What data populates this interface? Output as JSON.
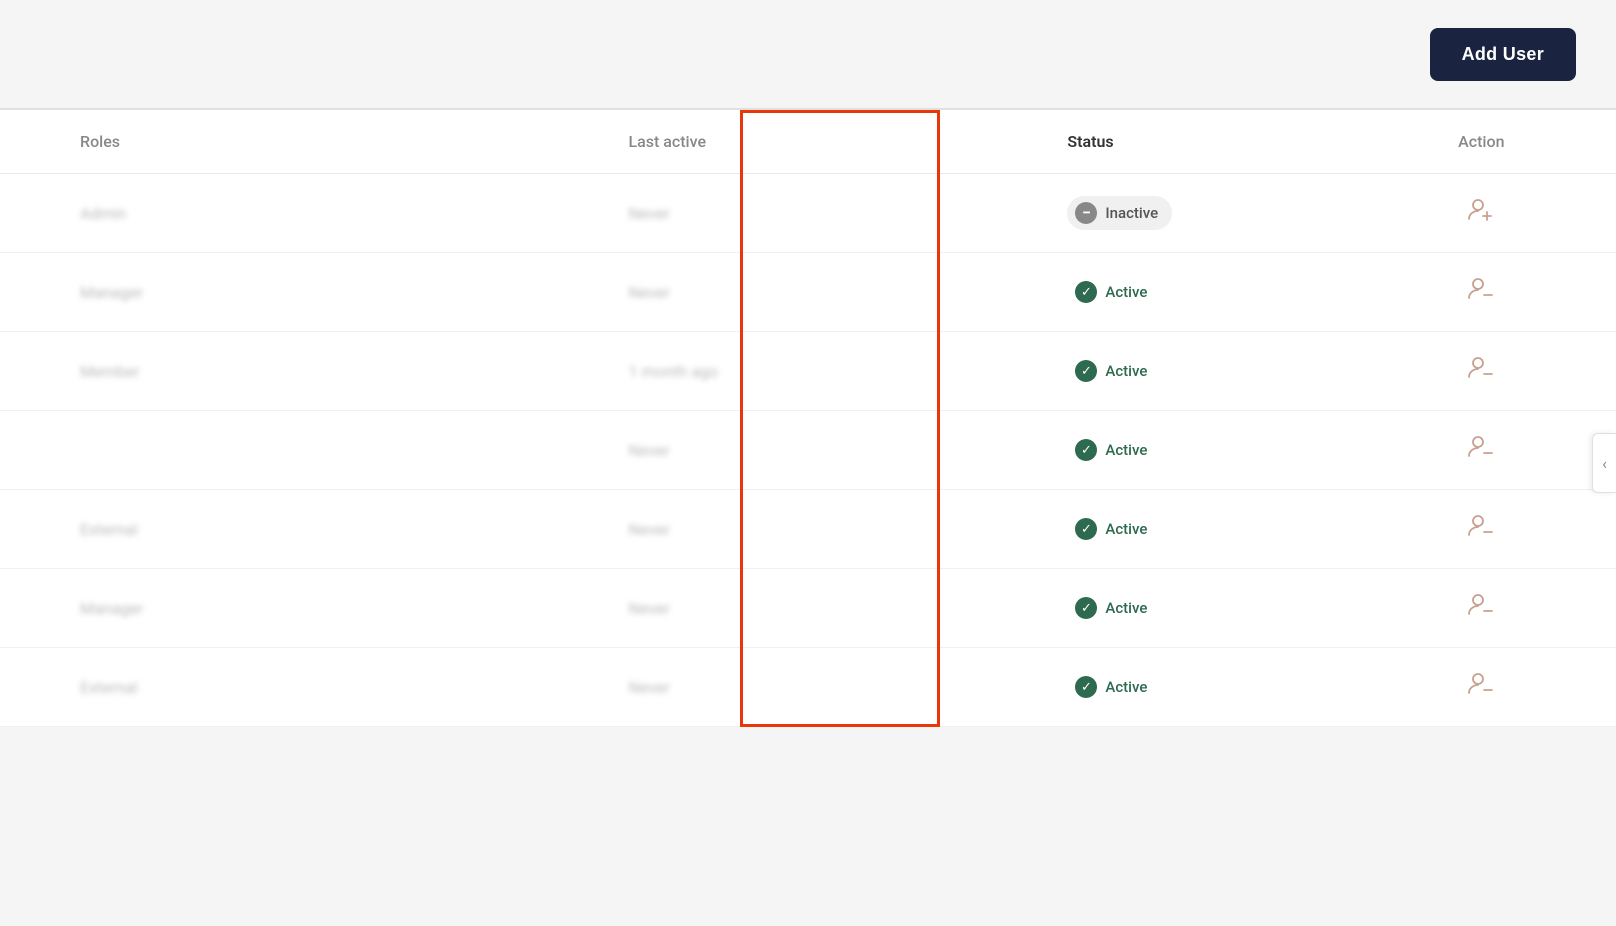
{
  "header": {
    "add_user_label": "Add User"
  },
  "table": {
    "columns": {
      "roles": "Roles",
      "last_active": "Last active",
      "status": "Status",
      "action": "Action"
    },
    "rows": [
      {
        "id": 1,
        "role": "Admin",
        "last_active": "Never",
        "status": "Inactive",
        "action_type": "add"
      },
      {
        "id": 2,
        "role": "Manager",
        "last_active": "Never",
        "status": "Active",
        "action_type": "remove"
      },
      {
        "id": 3,
        "role": "Member",
        "last_active": "1 month ago",
        "status": "Active",
        "action_type": "remove"
      },
      {
        "id": 4,
        "role": "",
        "last_active": "Never",
        "status": "Active",
        "action_type": "remove"
      },
      {
        "id": 5,
        "role": "External",
        "last_active": "Never",
        "status": "Active",
        "action_type": "remove"
      },
      {
        "id": 6,
        "role": "Manager",
        "last_active": "Never",
        "status": "Active",
        "action_type": "remove"
      },
      {
        "id": 7,
        "role": "External",
        "last_active": "Never",
        "status": "Active",
        "action_type": "remove"
      }
    ]
  },
  "colors": {
    "active_green": "#2d6a4f",
    "inactive_gray": "#888888",
    "highlight_orange": "#e8380a",
    "add_user_bg": "#1a2340"
  }
}
